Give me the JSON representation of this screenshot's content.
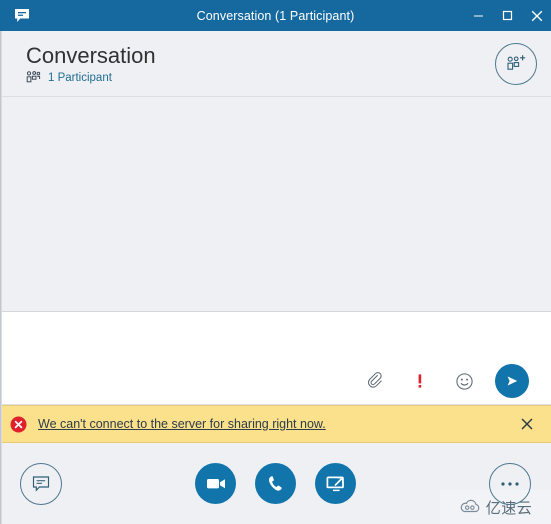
{
  "window": {
    "title": "Conversation (1 Participant)",
    "app_icon": "chat-bubble-icon",
    "controls": {
      "minimize_label": "Minimize",
      "maximize_label": "Maximize",
      "close_label": "Close"
    }
  },
  "header": {
    "title": "Conversation",
    "participants_icon": "people-icon",
    "participants_label": "1 Participant",
    "add_participant_label": "Add Participants",
    "add_participant_icon": "add-people-icon"
  },
  "message_area": {
    "content": ""
  },
  "compose": {
    "placeholder": "",
    "value": "",
    "actions": [
      {
        "name": "attach-file",
        "icon": "paperclip-icon",
        "label": "Attach File"
      },
      {
        "name": "high-importance",
        "icon": "exclamation-icon",
        "label": "Set High Importance"
      },
      {
        "name": "emoticon",
        "icon": "emoji-icon",
        "label": "Select an Emoticon"
      }
    ],
    "send_label": "Send",
    "send_icon": "send-arrow-icon"
  },
  "notification": {
    "icon": "error-circle-icon",
    "message": "We can't connect to the server for sharing right now.",
    "close_label": "Dismiss",
    "close_icon": "close-icon",
    "background_color": "#fbe18b",
    "icon_color": "#e81123"
  },
  "toolbar": {
    "im_label": "Instant Message",
    "im_icon": "chat-bubble-icon",
    "video_label": "Video Call",
    "video_icon": "video-camera-icon",
    "call_label": "Call",
    "call_icon": "phone-icon",
    "present_label": "Present",
    "present_icon": "monitor-share-icon",
    "more_label": "More Options",
    "more_icon": "ellipsis-icon"
  },
  "watermark": {
    "text": "亿速云",
    "icon": "cloud-logo-icon"
  },
  "colors": {
    "titlebar": "#16699e",
    "accent": "#1175ac",
    "header_bg": "#eff0f4",
    "link": "#1f6e8f",
    "notification_bg": "#fbe18b",
    "alert_red": "#e81123"
  }
}
